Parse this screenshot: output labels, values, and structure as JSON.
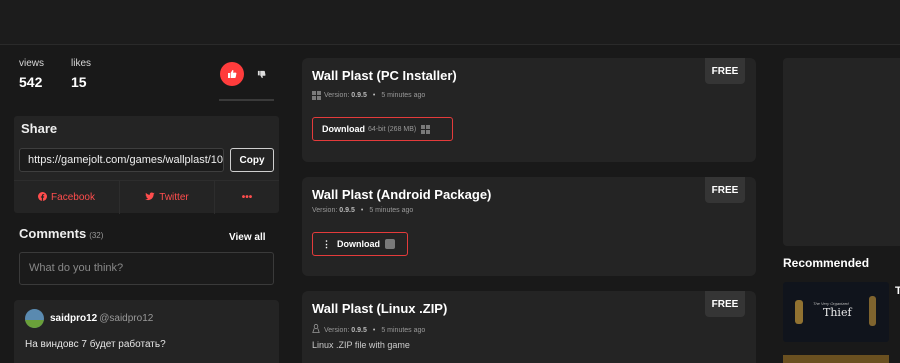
{
  "stats": {
    "views_label": "views",
    "views_value": "542",
    "likes_label": "likes",
    "likes_value": "15"
  },
  "share": {
    "title": "Share",
    "url": "https://gamejolt.com/games/wallplast/10",
    "copy_label": "Copy",
    "facebook_label": "Facebook",
    "twitter_label": "Twitter",
    "more_label": "•••"
  },
  "comments": {
    "title": "Comments",
    "count": "(32)",
    "view_all": "View all",
    "input_placeholder": "What do you think?",
    "items": [
      {
        "user": "saidpro12",
        "handle": "@saidpro12",
        "text": "На виндовс 7 будет работать?"
      }
    ]
  },
  "builds": [
    {
      "title": "Wall Plast (PC Installer)",
      "version_label": "Version:",
      "version": "0.9.5",
      "time": "5 minutes ago",
      "free": "FREE",
      "download_label": "Download",
      "download_sub": "64-bit (268 MB)",
      "icon": "windows-icon"
    },
    {
      "title": "Wall Plast (Android Package)",
      "version_label": "Version:",
      "version": "0.9.5",
      "time": "5 minutes ago",
      "free": "FREE",
      "download_label": "Download",
      "icon": "android-icon"
    },
    {
      "title": "Wall Plast (Linux .ZIP)",
      "version_label": "Version:",
      "version": "0.9.5",
      "time": "5 minutes ago",
      "free": "FREE",
      "description": "Linux .ZIP file with game",
      "icon": "linux-icon"
    }
  ],
  "recommended": {
    "title": "Recommended",
    "items": [
      {
        "small_text": "The Very Organized",
        "name": "Thief",
        "next_initial": "T"
      }
    ]
  },
  "colors": {
    "accent": "#ff3c3c",
    "background": "#191919",
    "card": "#242424"
  }
}
